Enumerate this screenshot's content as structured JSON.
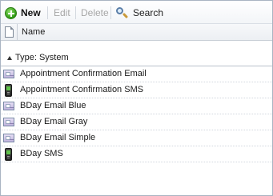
{
  "toolbar": {
    "new_label": "New",
    "edit_label": "Edit",
    "delete_label": "Delete",
    "search_label": "Search"
  },
  "list": {
    "column_name": "Name",
    "group_label": "Type:  System",
    "items": [
      {
        "label": "Appointment  Confirmation  Email",
        "icon": "email-template-icon"
      },
      {
        "label": "Appointment  Confirmation  SMS",
        "icon": "sms-template-icon"
      },
      {
        "label": "BDay Email Blue",
        "icon": "email-template-icon"
      },
      {
        "label": "BDay Email Gray",
        "icon": "email-template-icon"
      },
      {
        "label": "BDay Email Simple",
        "icon": "email-template-icon"
      },
      {
        "label": "BDay SMS",
        "icon": "sms-template-icon"
      }
    ]
  }
}
